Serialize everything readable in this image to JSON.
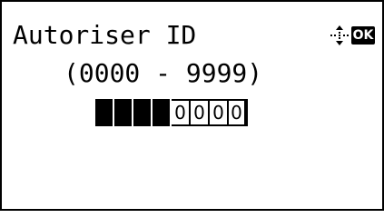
{
  "screen": {
    "title": "Autoriser ID",
    "range": "(0000 - 9999)",
    "ok_label": "OK",
    "icons": {
      "navigation": "dpad-navigation-icon",
      "ok": "ok-icon"
    }
  },
  "id_input": {
    "empty_cells": 4,
    "digits": [
      "0",
      "0",
      "0",
      "0"
    ],
    "value": "0000"
  }
}
